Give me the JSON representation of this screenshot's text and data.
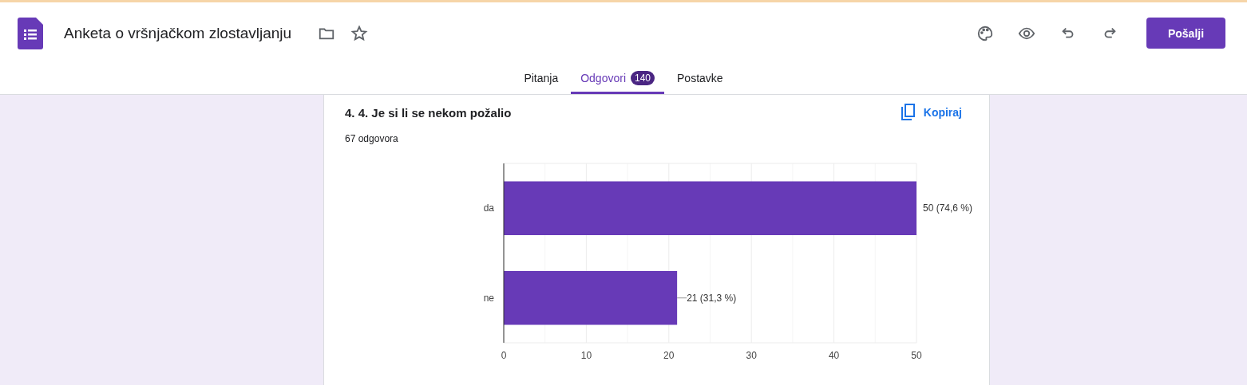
{
  "header": {
    "title": "Anketa o vršnjačkom zlostavljanju",
    "send_button": "Pošalji"
  },
  "tabs": [
    {
      "label": "Pitanja",
      "selected": false
    },
    {
      "label": "Odgovori",
      "selected": true,
      "badge": "140"
    },
    {
      "label": "Postavke",
      "selected": false
    }
  ],
  "question": {
    "title": "4. 4. Je si li se nekom požalio",
    "copy_button": "Kopiraj",
    "response_count": "67 odgovora",
    "chart_data": {
      "type": "bar",
      "orientation": "horizontal",
      "categories": [
        "da",
        "ne"
      ],
      "series": [
        {
          "color": "#673ab7",
          "values": [
            50,
            21
          ]
        }
      ],
      "grid": true,
      "xlim": [
        0,
        50
      ],
      "xticks": [
        0,
        10,
        20,
        30,
        40,
        50
      ],
      "value_labels": [
        "50 (74,6 %)",
        "21 (31,3 %)"
      ]
    }
  }
}
